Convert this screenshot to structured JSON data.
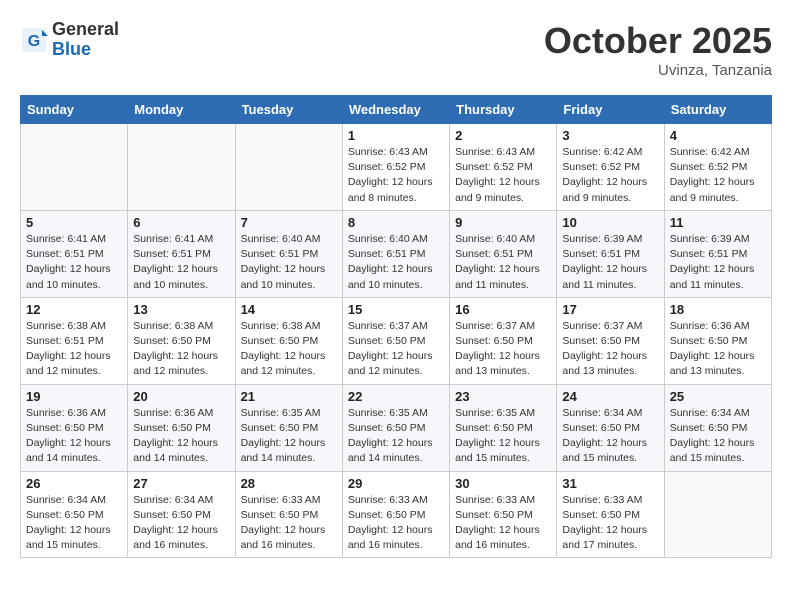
{
  "header": {
    "logo": {
      "general": "General",
      "blue": "Blue"
    },
    "title": "October 2025",
    "subtitle": "Uvinza, Tanzania"
  },
  "weekdays": [
    "Sunday",
    "Monday",
    "Tuesday",
    "Wednesday",
    "Thursday",
    "Friday",
    "Saturday"
  ],
  "weeks": [
    [
      {
        "day": "",
        "info": ""
      },
      {
        "day": "",
        "info": ""
      },
      {
        "day": "",
        "info": ""
      },
      {
        "day": "1",
        "info": "Sunrise: 6:43 AM\nSunset: 6:52 PM\nDaylight: 12 hours and 8 minutes."
      },
      {
        "day": "2",
        "info": "Sunrise: 6:43 AM\nSunset: 6:52 PM\nDaylight: 12 hours and 9 minutes."
      },
      {
        "day": "3",
        "info": "Sunrise: 6:42 AM\nSunset: 6:52 PM\nDaylight: 12 hours and 9 minutes."
      },
      {
        "day": "4",
        "info": "Sunrise: 6:42 AM\nSunset: 6:52 PM\nDaylight: 12 hours and 9 minutes."
      }
    ],
    [
      {
        "day": "5",
        "info": "Sunrise: 6:41 AM\nSunset: 6:51 PM\nDaylight: 12 hours and 10 minutes."
      },
      {
        "day": "6",
        "info": "Sunrise: 6:41 AM\nSunset: 6:51 PM\nDaylight: 12 hours and 10 minutes."
      },
      {
        "day": "7",
        "info": "Sunrise: 6:40 AM\nSunset: 6:51 PM\nDaylight: 12 hours and 10 minutes."
      },
      {
        "day": "8",
        "info": "Sunrise: 6:40 AM\nSunset: 6:51 PM\nDaylight: 12 hours and 10 minutes."
      },
      {
        "day": "9",
        "info": "Sunrise: 6:40 AM\nSunset: 6:51 PM\nDaylight: 12 hours and 11 minutes."
      },
      {
        "day": "10",
        "info": "Sunrise: 6:39 AM\nSunset: 6:51 PM\nDaylight: 12 hours and 11 minutes."
      },
      {
        "day": "11",
        "info": "Sunrise: 6:39 AM\nSunset: 6:51 PM\nDaylight: 12 hours and 11 minutes."
      }
    ],
    [
      {
        "day": "12",
        "info": "Sunrise: 6:38 AM\nSunset: 6:51 PM\nDaylight: 12 hours and 12 minutes."
      },
      {
        "day": "13",
        "info": "Sunrise: 6:38 AM\nSunset: 6:50 PM\nDaylight: 12 hours and 12 minutes."
      },
      {
        "day": "14",
        "info": "Sunrise: 6:38 AM\nSunset: 6:50 PM\nDaylight: 12 hours and 12 minutes."
      },
      {
        "day": "15",
        "info": "Sunrise: 6:37 AM\nSunset: 6:50 PM\nDaylight: 12 hours and 12 minutes."
      },
      {
        "day": "16",
        "info": "Sunrise: 6:37 AM\nSunset: 6:50 PM\nDaylight: 12 hours and 13 minutes."
      },
      {
        "day": "17",
        "info": "Sunrise: 6:37 AM\nSunset: 6:50 PM\nDaylight: 12 hours and 13 minutes."
      },
      {
        "day": "18",
        "info": "Sunrise: 6:36 AM\nSunset: 6:50 PM\nDaylight: 12 hours and 13 minutes."
      }
    ],
    [
      {
        "day": "19",
        "info": "Sunrise: 6:36 AM\nSunset: 6:50 PM\nDaylight: 12 hours and 14 minutes."
      },
      {
        "day": "20",
        "info": "Sunrise: 6:36 AM\nSunset: 6:50 PM\nDaylight: 12 hours and 14 minutes."
      },
      {
        "day": "21",
        "info": "Sunrise: 6:35 AM\nSunset: 6:50 PM\nDaylight: 12 hours and 14 minutes."
      },
      {
        "day": "22",
        "info": "Sunrise: 6:35 AM\nSunset: 6:50 PM\nDaylight: 12 hours and 14 minutes."
      },
      {
        "day": "23",
        "info": "Sunrise: 6:35 AM\nSunset: 6:50 PM\nDaylight: 12 hours and 15 minutes."
      },
      {
        "day": "24",
        "info": "Sunrise: 6:34 AM\nSunset: 6:50 PM\nDaylight: 12 hours and 15 minutes."
      },
      {
        "day": "25",
        "info": "Sunrise: 6:34 AM\nSunset: 6:50 PM\nDaylight: 12 hours and 15 minutes."
      }
    ],
    [
      {
        "day": "26",
        "info": "Sunrise: 6:34 AM\nSunset: 6:50 PM\nDaylight: 12 hours and 15 minutes."
      },
      {
        "day": "27",
        "info": "Sunrise: 6:34 AM\nSunset: 6:50 PM\nDaylight: 12 hours and 16 minutes."
      },
      {
        "day": "28",
        "info": "Sunrise: 6:33 AM\nSunset: 6:50 PM\nDaylight: 12 hours and 16 minutes."
      },
      {
        "day": "29",
        "info": "Sunrise: 6:33 AM\nSunset: 6:50 PM\nDaylight: 12 hours and 16 minutes."
      },
      {
        "day": "30",
        "info": "Sunrise: 6:33 AM\nSunset: 6:50 PM\nDaylight: 12 hours and 16 minutes."
      },
      {
        "day": "31",
        "info": "Sunrise: 6:33 AM\nSunset: 6:50 PM\nDaylight: 12 hours and 17 minutes."
      },
      {
        "day": "",
        "info": ""
      }
    ]
  ]
}
